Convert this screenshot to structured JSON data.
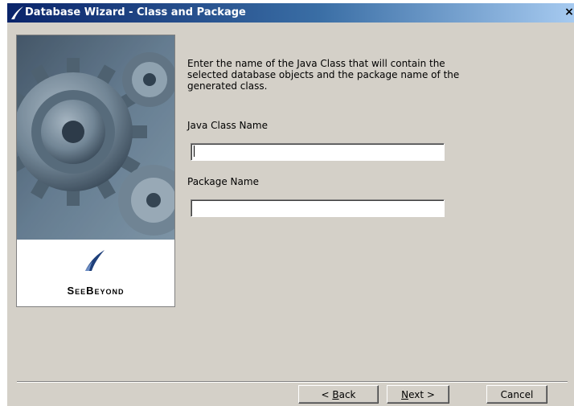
{
  "window": {
    "title": "Database Wizard - Class and Package",
    "close_symbol": "×",
    "title_icon": "seebeyond-swoosh-icon"
  },
  "side_panel": {
    "image": "gears-illustration",
    "brand": "SeeBeyond"
  },
  "content": {
    "instructions": "Enter the name of the Java Class that will contain the selected database objects and the package name of the generated class.",
    "java_class_label": "Java Class Name",
    "java_class_value": "",
    "package_label": "Package Name",
    "package_value": ""
  },
  "buttons": {
    "back_prefix": "< ",
    "back_mnemonic": "B",
    "back_rest": "ack",
    "next_mnemonic": "N",
    "next_rest": "ext >",
    "cancel": "Cancel"
  },
  "colors": {
    "dialog_bg": "#d4d0c8",
    "titlebar_start": "#0a246a",
    "titlebar_end": "#a6caf0",
    "logo_blue": "#1e3f7a"
  }
}
